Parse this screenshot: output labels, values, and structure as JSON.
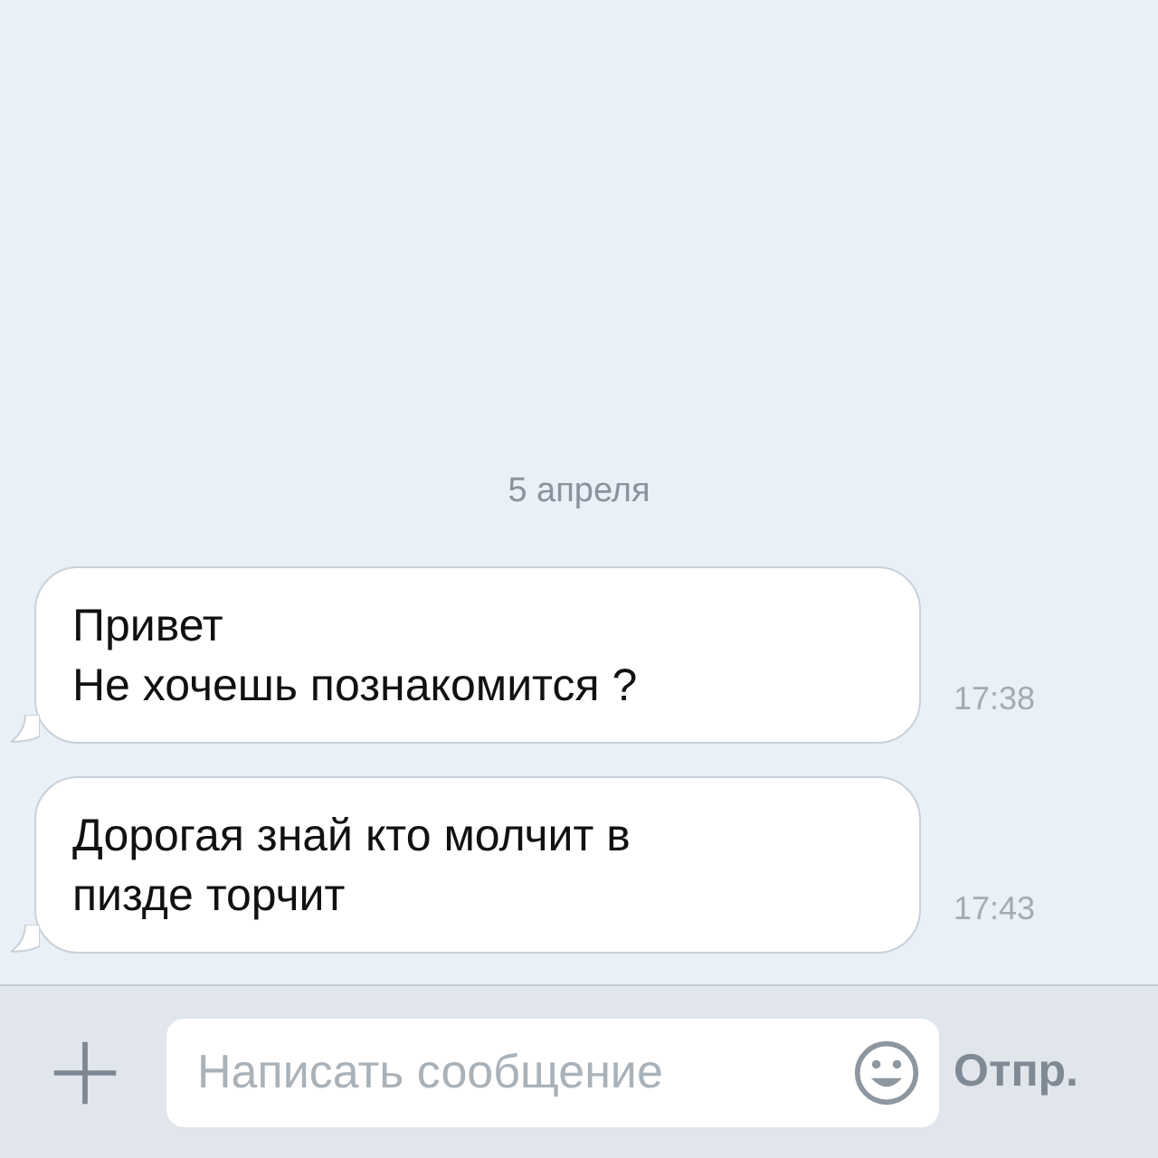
{
  "date_separator": "5 апреля",
  "messages": [
    {
      "text": "Привет\nНе хочешь познакомится ?",
      "time": "17:38"
    },
    {
      "text": "Дорогая знай кто молчит в\nпизде торчит",
      "time": "17:43"
    }
  ],
  "composer": {
    "placeholder": "Написать сообщение",
    "send_label": "Отпр."
  }
}
